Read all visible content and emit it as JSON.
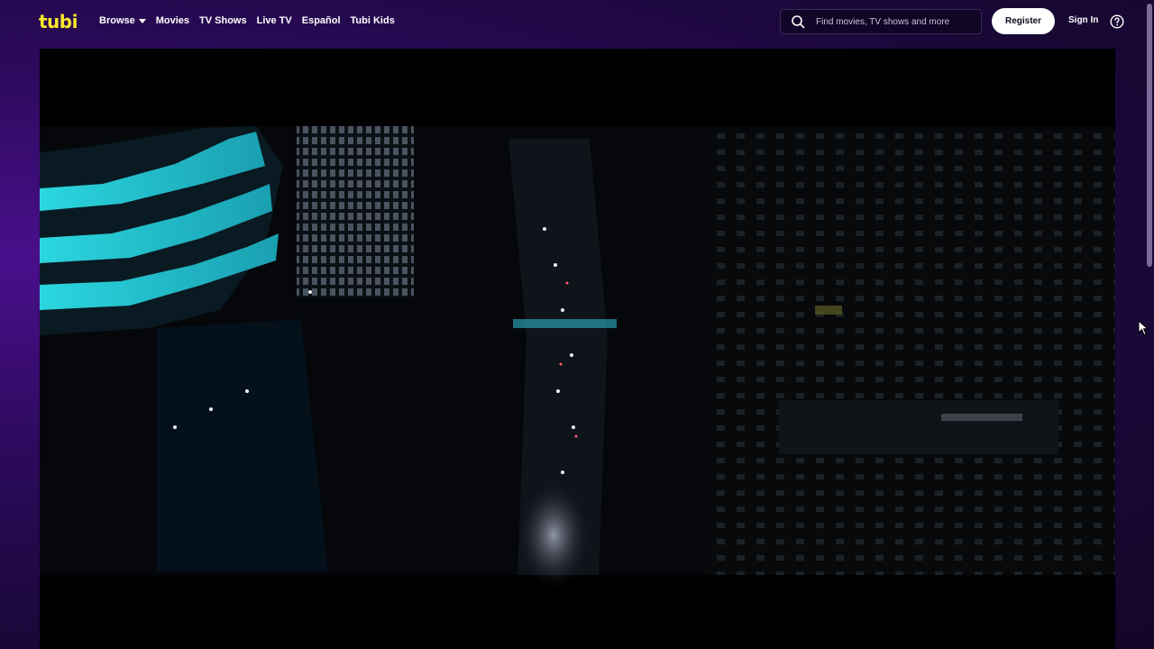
{
  "header": {
    "logo": "tubi",
    "nav": [
      {
        "label": "Browse",
        "has_dropdown": true
      },
      {
        "label": "Movies"
      },
      {
        "label": "TV Shows"
      },
      {
        "label": "Live TV"
      },
      {
        "label": "Español"
      },
      {
        "label": "Tubi Kids"
      }
    ],
    "search": {
      "placeholder": "Find movies, TV shows and more",
      "value": ""
    },
    "register_label": "Register",
    "signin_label": "Sign In"
  },
  "colors": {
    "brand_yellow": "#fcea2b",
    "background_purple": "#2c0a5c",
    "player_black": "#000000"
  },
  "icons": {
    "search": "search-icon",
    "help": "help-circle-icon",
    "caret": "chevron-down-icon"
  },
  "player": {
    "scene": "night city aerial video frame"
  }
}
